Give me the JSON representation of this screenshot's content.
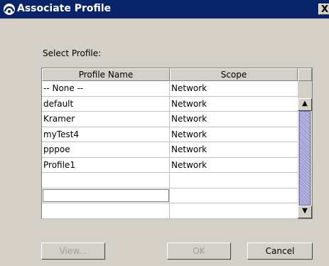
{
  "window": {
    "title": "Associate Profile",
    "close_glyph": "X",
    "icon": "app-logo-icon"
  },
  "section": {
    "label": "Select Profile:"
  },
  "table": {
    "columns": [
      "Profile Name",
      "Scope"
    ],
    "rows": [
      {
        "name": "-- None --",
        "scope": "Network"
      },
      {
        "name": "default",
        "scope": "Network"
      },
      {
        "name": "Kramer",
        "scope": "Network"
      },
      {
        "name": "myTest4",
        "scope": "Network"
      },
      {
        "name": "pppoe",
        "scope": "Network"
      },
      {
        "name": "Profile1",
        "scope": "Network"
      },
      {
        "name": "",
        "scope": ""
      },
      {
        "name": "",
        "scope": ""
      },
      {
        "name": "",
        "scope": ""
      }
    ]
  },
  "scrollbar": {
    "up_glyph": "▲",
    "down_glyph": "▼"
  },
  "buttons": {
    "view": "View...",
    "ok": "OK",
    "cancel": "Cancel"
  }
}
